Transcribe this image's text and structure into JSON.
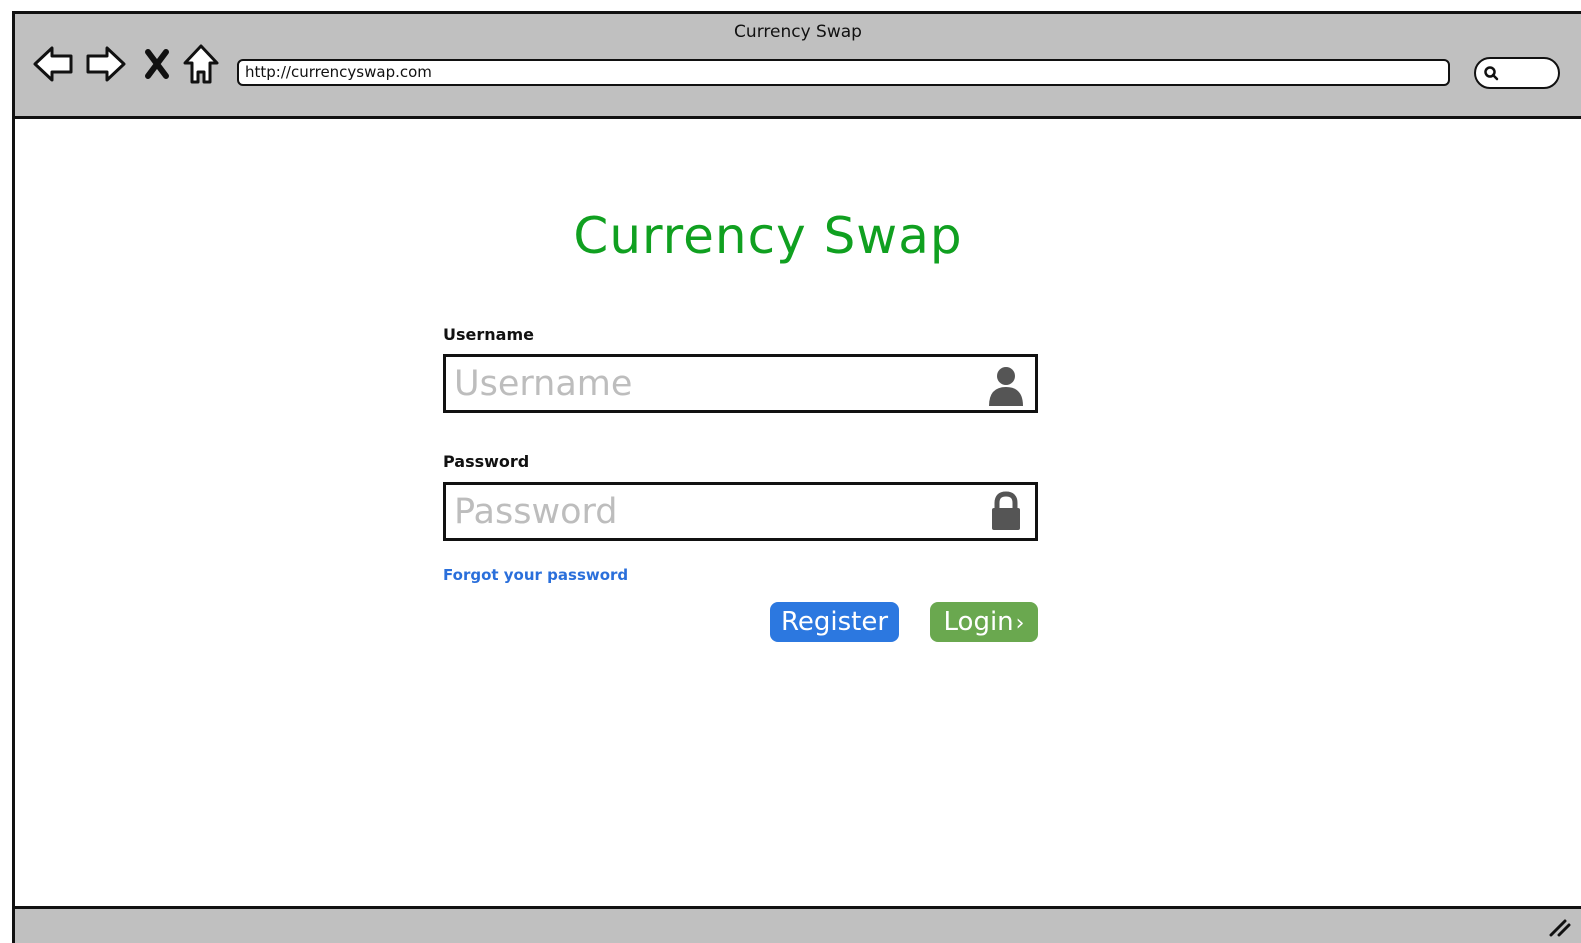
{
  "window": {
    "title": "Currency Swap",
    "url": "http://currencyswap.com"
  },
  "toolbar": {
    "back_icon": "back-arrow-icon",
    "forward_icon": "forward-arrow-icon",
    "stop_icon": "close-icon",
    "home_icon": "home-icon",
    "search_icon": "search-icon"
  },
  "login": {
    "app_title": "Currency Swap",
    "username_label": "Username",
    "username_placeholder": "Username",
    "username_icon": "user-icon",
    "password_label": "Password",
    "password_placeholder": "Password",
    "password_icon": "lock-icon",
    "forgot_link": "Forgot your password",
    "register_label": "Register",
    "login_label": "Login"
  },
  "colors": {
    "title": "#10a020",
    "register_button": "#2c78e0",
    "login_button": "#6aa84f",
    "link": "#2a6fdb",
    "chrome": "#c0c0c0"
  }
}
